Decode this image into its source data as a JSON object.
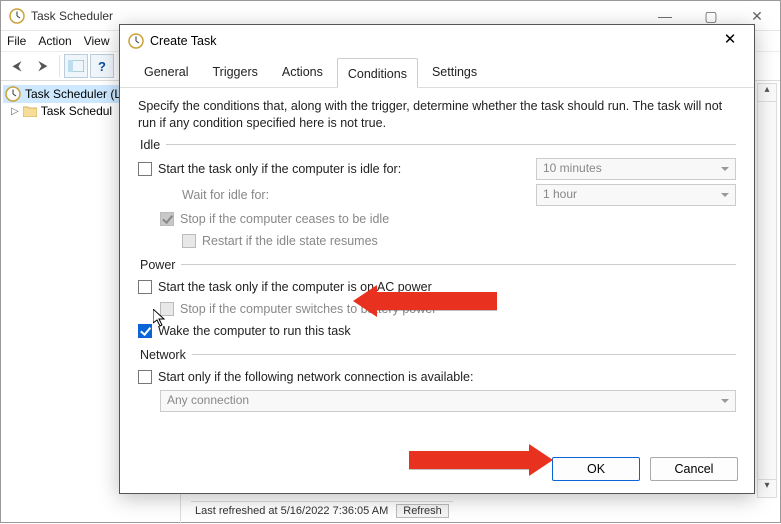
{
  "main": {
    "title": "Task Scheduler",
    "menus": [
      "File",
      "Action",
      "View"
    ],
    "sidebar": {
      "root": "Task Scheduler (L",
      "child": "Task Schedul"
    },
    "status_prefix": "Last refreshed at 5/16/2022 7:36:05 AM",
    "refresh": "Refresh"
  },
  "dialog": {
    "title": "Create Task",
    "tabs": [
      "General",
      "Triggers",
      "Actions",
      "Conditions",
      "Settings"
    ],
    "active_tab": "Conditions",
    "description": "Specify the conditions that, along with the trigger, determine whether the task should run.  The task will not run  if any condition specified here is not true.",
    "idle": {
      "legend": "Idle",
      "start_only_idle": "Start the task only if the computer is idle for:",
      "idle_duration": "10 minutes",
      "wait_label": "Wait for idle for:",
      "wait_duration": "1 hour",
      "stop_not_idle": "Stop if the computer ceases to be idle",
      "restart_idle": "Restart if the idle state resumes"
    },
    "power": {
      "legend": "Power",
      "ac_only": "Start the task only if the computer is on AC power",
      "stop_battery": "Stop if the computer switches to battery power",
      "wake": "Wake the computer to run this task"
    },
    "network": {
      "legend": "Network",
      "start_net": "Start only if the following network connection is available:",
      "connection": "Any connection"
    },
    "ok": "OK",
    "cancel": "Cancel"
  }
}
